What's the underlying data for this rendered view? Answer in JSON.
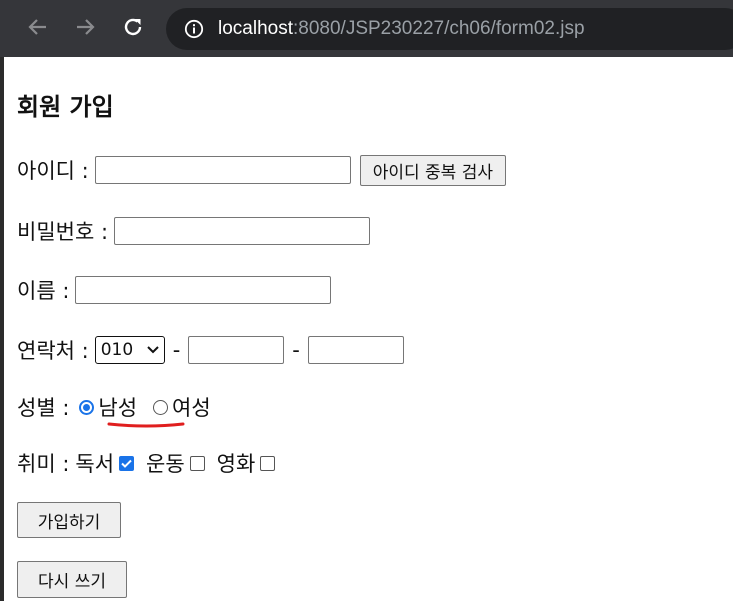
{
  "browser": {
    "url_host": "localhost",
    "url_path": ":8080/JSP230227/ch06/form02.jsp",
    "icons": [
      "back-arrow-icon",
      "forward-arrow-icon",
      "reload-icon",
      "info-icon"
    ]
  },
  "form": {
    "title": "회원 가입",
    "id_label": "아이디 :",
    "id_check_button": "아이디 중복 검사",
    "pw_label": "비밀번호 :",
    "name_label": "이름 :",
    "phone_label": "연락처 :",
    "phone_prefix": "010",
    "phone_dash": "-",
    "gender_label": "성별 :",
    "gender_male": "남성",
    "gender_female": "여성",
    "gender_selected": "남성",
    "hobby_label": "취미 :",
    "hobbies": [
      {
        "label": "독서",
        "checked": true
      },
      {
        "label": "운동",
        "checked": false
      },
      {
        "label": "영화",
        "checked": false
      }
    ],
    "submit_label": "가입하기",
    "reset_label": "다시 쓰기"
  },
  "colors": {
    "toolbar": "#35363a",
    "address_bar": "#202124",
    "accent": "#1a73e8",
    "annotation": "#e01e1e"
  }
}
